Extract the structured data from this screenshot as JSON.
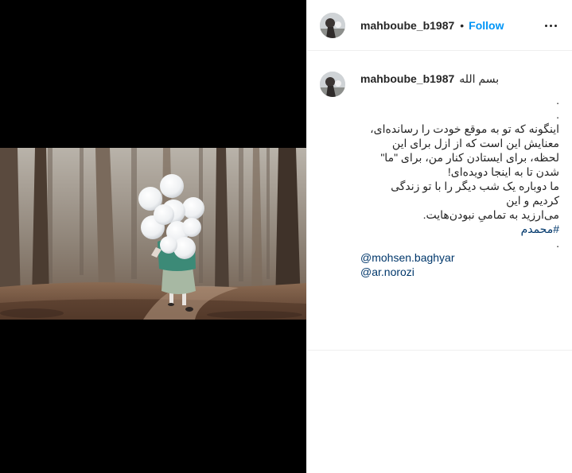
{
  "post": {
    "author": {
      "username": "mahboube_b1987",
      "follow_label": "Follow",
      "separator": "•"
    },
    "caption": {
      "username": "mahboube_b1987",
      "first_line": "بسم الله",
      "lines": [
        ".",
        ".",
        "اینگونه که تو به موقع خودت را رسانده‌ای،",
        "معنایش این است که از ازل برای این",
        "لحظه، برای ایستادن کنار من، برای \"ما\"",
        "شدن تا به اینجا دویده‌ای!",
        "ما دوباره یک شب دیگر را با تو زندگی",
        "کردیم و این",
        "می‌ارزید به تمامیِ نبودن‌هایت."
      ],
      "hashtag": "#محمدم",
      "dot_after_hashtag": ".",
      "mentions": [
        "@mohsen.baghyar",
        "@ar.norozi"
      ]
    }
  },
  "icons": {
    "more": "more-options-icon"
  },
  "colors": {
    "link": "#00376b",
    "follow": "#0095f6",
    "text": "#262626",
    "border": "#efefef",
    "media_bg": "#000000"
  }
}
